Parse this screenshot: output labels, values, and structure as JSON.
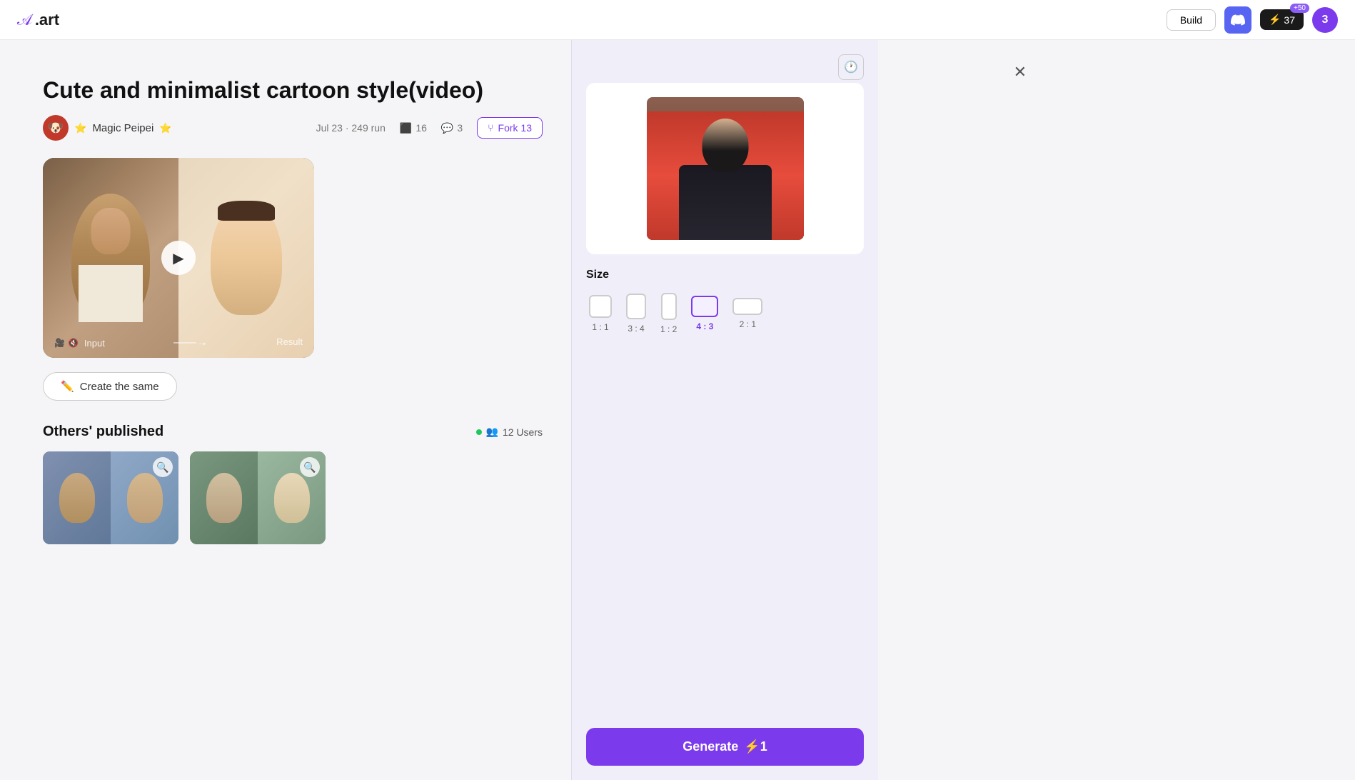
{
  "header": {
    "logo_text": ".art",
    "build_label": "Build",
    "credits_count": "37",
    "credits_badge": "+50",
    "avatar_letter": "3"
  },
  "page": {
    "title": "Cute and minimalist cartoon style(video)",
    "author_name": "Magic Peipei",
    "author_emoji_left": "⭐",
    "author_emoji_right": "⭐",
    "date": "Jul 23",
    "run_count": "249 run",
    "like_count": "16",
    "comment_count": "3",
    "fork_label": "Fork 13",
    "create_same_label": "Create the same",
    "others_title": "Others' published",
    "users_online_label": "12 Users"
  },
  "size": {
    "label": "Size",
    "options": [
      {
        "ratio": "1 : 1",
        "key": "1-1",
        "active": false
      },
      {
        "ratio": "3 : 4",
        "key": "3-4",
        "active": false
      },
      {
        "ratio": "1 : 2",
        "key": "1-2",
        "active": false
      },
      {
        "ratio": "4 : 3",
        "key": "4-3",
        "active": true
      },
      {
        "ratio": "2 : 1",
        "key": "2-1",
        "active": false
      }
    ]
  },
  "generate": {
    "label": "Generate",
    "cost": "⚡1"
  },
  "preview": {
    "input_label": "Input",
    "result_label": "Result"
  }
}
